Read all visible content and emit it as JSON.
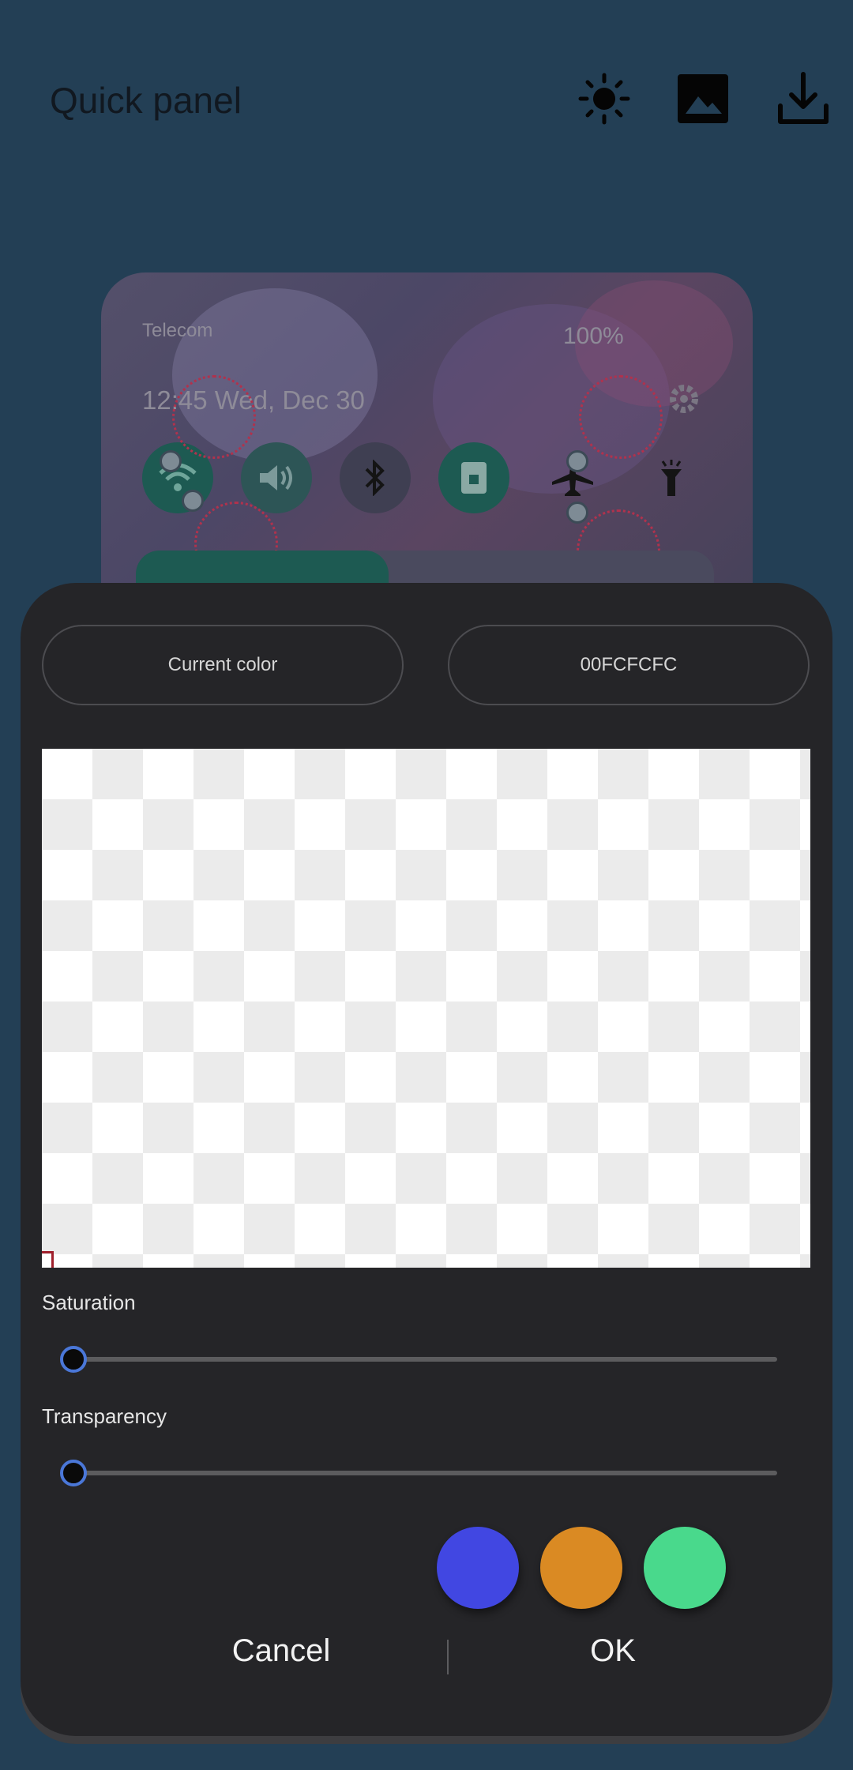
{
  "header": {
    "title": "Quick panel",
    "icons": [
      "brightness-icon",
      "image-icon",
      "download-icon"
    ]
  },
  "preview": {
    "carrier": "Telecom",
    "status": "100%",
    "datetime": "12:45  Wed, Dec 30"
  },
  "dialog": {
    "current_color_label": "Current color",
    "hex_value": "00FCFCFC",
    "saturation_label": "Saturation",
    "saturation_value": 0,
    "transparency_label": "Transparency",
    "transparency_value": 0,
    "swatches": [
      "#4147e2",
      "#da8a23",
      "#49d98c"
    ],
    "cancel_label": "Cancel",
    "ok_label": "OK"
  },
  "colors": {
    "background": "#233f55",
    "sheet": "#252528",
    "accent": "#4a77d8"
  }
}
